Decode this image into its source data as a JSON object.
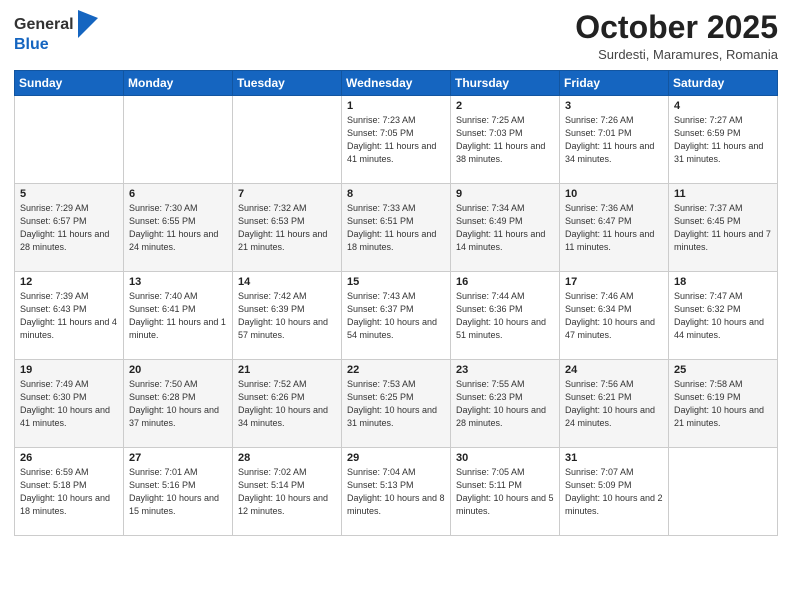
{
  "logo": {
    "general": "General",
    "blue": "Blue"
  },
  "header": {
    "month": "October 2025",
    "location": "Surdesti, Maramures, Romania"
  },
  "days_of_week": [
    "Sunday",
    "Monday",
    "Tuesday",
    "Wednesday",
    "Thursday",
    "Friday",
    "Saturday"
  ],
  "weeks": [
    [
      {
        "day": "",
        "info": ""
      },
      {
        "day": "",
        "info": ""
      },
      {
        "day": "",
        "info": ""
      },
      {
        "day": "1",
        "info": "Sunrise: 7:23 AM\nSunset: 7:05 PM\nDaylight: 11 hours and 41 minutes."
      },
      {
        "day": "2",
        "info": "Sunrise: 7:25 AM\nSunset: 7:03 PM\nDaylight: 11 hours and 38 minutes."
      },
      {
        "day": "3",
        "info": "Sunrise: 7:26 AM\nSunset: 7:01 PM\nDaylight: 11 hours and 34 minutes."
      },
      {
        "day": "4",
        "info": "Sunrise: 7:27 AM\nSunset: 6:59 PM\nDaylight: 11 hours and 31 minutes."
      }
    ],
    [
      {
        "day": "5",
        "info": "Sunrise: 7:29 AM\nSunset: 6:57 PM\nDaylight: 11 hours and 28 minutes."
      },
      {
        "day": "6",
        "info": "Sunrise: 7:30 AM\nSunset: 6:55 PM\nDaylight: 11 hours and 24 minutes."
      },
      {
        "day": "7",
        "info": "Sunrise: 7:32 AM\nSunset: 6:53 PM\nDaylight: 11 hours and 21 minutes."
      },
      {
        "day": "8",
        "info": "Sunrise: 7:33 AM\nSunset: 6:51 PM\nDaylight: 11 hours and 18 minutes."
      },
      {
        "day": "9",
        "info": "Sunrise: 7:34 AM\nSunset: 6:49 PM\nDaylight: 11 hours and 14 minutes."
      },
      {
        "day": "10",
        "info": "Sunrise: 7:36 AM\nSunset: 6:47 PM\nDaylight: 11 hours and 11 minutes."
      },
      {
        "day": "11",
        "info": "Sunrise: 7:37 AM\nSunset: 6:45 PM\nDaylight: 11 hours and 7 minutes."
      }
    ],
    [
      {
        "day": "12",
        "info": "Sunrise: 7:39 AM\nSunset: 6:43 PM\nDaylight: 11 hours and 4 minutes."
      },
      {
        "day": "13",
        "info": "Sunrise: 7:40 AM\nSunset: 6:41 PM\nDaylight: 11 hours and 1 minute."
      },
      {
        "day": "14",
        "info": "Sunrise: 7:42 AM\nSunset: 6:39 PM\nDaylight: 10 hours and 57 minutes."
      },
      {
        "day": "15",
        "info": "Sunrise: 7:43 AM\nSunset: 6:37 PM\nDaylight: 10 hours and 54 minutes."
      },
      {
        "day": "16",
        "info": "Sunrise: 7:44 AM\nSunset: 6:36 PM\nDaylight: 10 hours and 51 minutes."
      },
      {
        "day": "17",
        "info": "Sunrise: 7:46 AM\nSunset: 6:34 PM\nDaylight: 10 hours and 47 minutes."
      },
      {
        "day": "18",
        "info": "Sunrise: 7:47 AM\nSunset: 6:32 PM\nDaylight: 10 hours and 44 minutes."
      }
    ],
    [
      {
        "day": "19",
        "info": "Sunrise: 7:49 AM\nSunset: 6:30 PM\nDaylight: 10 hours and 41 minutes."
      },
      {
        "day": "20",
        "info": "Sunrise: 7:50 AM\nSunset: 6:28 PM\nDaylight: 10 hours and 37 minutes."
      },
      {
        "day": "21",
        "info": "Sunrise: 7:52 AM\nSunset: 6:26 PM\nDaylight: 10 hours and 34 minutes."
      },
      {
        "day": "22",
        "info": "Sunrise: 7:53 AM\nSunset: 6:25 PM\nDaylight: 10 hours and 31 minutes."
      },
      {
        "day": "23",
        "info": "Sunrise: 7:55 AM\nSunset: 6:23 PM\nDaylight: 10 hours and 28 minutes."
      },
      {
        "day": "24",
        "info": "Sunrise: 7:56 AM\nSunset: 6:21 PM\nDaylight: 10 hours and 24 minutes."
      },
      {
        "day": "25",
        "info": "Sunrise: 7:58 AM\nSunset: 6:19 PM\nDaylight: 10 hours and 21 minutes."
      }
    ],
    [
      {
        "day": "26",
        "info": "Sunrise: 6:59 AM\nSunset: 5:18 PM\nDaylight: 10 hours and 18 minutes."
      },
      {
        "day": "27",
        "info": "Sunrise: 7:01 AM\nSunset: 5:16 PM\nDaylight: 10 hours and 15 minutes."
      },
      {
        "day": "28",
        "info": "Sunrise: 7:02 AM\nSunset: 5:14 PM\nDaylight: 10 hours and 12 minutes."
      },
      {
        "day": "29",
        "info": "Sunrise: 7:04 AM\nSunset: 5:13 PM\nDaylight: 10 hours and 8 minutes."
      },
      {
        "day": "30",
        "info": "Sunrise: 7:05 AM\nSunset: 5:11 PM\nDaylight: 10 hours and 5 minutes."
      },
      {
        "day": "31",
        "info": "Sunrise: 7:07 AM\nSunset: 5:09 PM\nDaylight: 10 hours and 2 minutes."
      },
      {
        "day": "",
        "info": ""
      }
    ]
  ]
}
